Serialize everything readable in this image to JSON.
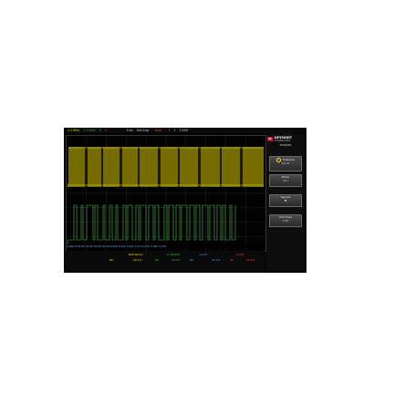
{
  "topbar": {
    "ch1_scale": "1 1.00V/",
    "ch2_scale": "2 1.00V/",
    "ch3_marker": "3",
    "ch4_marker": "4",
    "time_pos": "0.0s",
    "time_scale": "500.0us/",
    "run_state": "Stop",
    "trig_marker": "F",
    "trig_level": "1",
    "trig_value": "2.50V"
  },
  "brand": {
    "name": "KEYSIGHT",
    "sub": "TECHNOLOGIES"
  },
  "sidebar": {
    "title": "Analyze",
    "buttons": [
      {
        "label": "Features",
        "sub": "Serial"
      },
      {
        "label": "Mode",
        "sub": "I2C"
      },
      {
        "label": "Signals",
        "sub": ""
      },
      {
        "label": "Addr Size",
        "sub": "7 Bit"
      }
    ]
  },
  "decode_row": "0:0Ah R 01:00 00:22 00:00 04:00 0:4Ah 0:4Ah 0:4Ah 0:1:0 0:4Ah 0:4Ah 0:4Ah",
  "bottom": {
    "ch1_v": "-820.00mV",
    "ch2_v": "+3.9000V",
    "ch3_v": "+0.0V",
    "ch4_v": "+0.0V",
    "ch1_coup": "DC",
    "ch1_scale": "10.0:1",
    "ch2_coup": "DC",
    "ch2_scale": "10.0:1",
    "ch3_coup": "DC",
    "ch3_scale": "10.0:1",
    "ch4_coup": "DC",
    "ch4_scale": "10.0:1"
  },
  "colors": {
    "ch1": "#f4e300",
    "ch2": "#4fb54f",
    "ch3": "#5aa0ff",
    "ch4": "#ff4040",
    "decode_text": "#6fb1ff"
  }
}
